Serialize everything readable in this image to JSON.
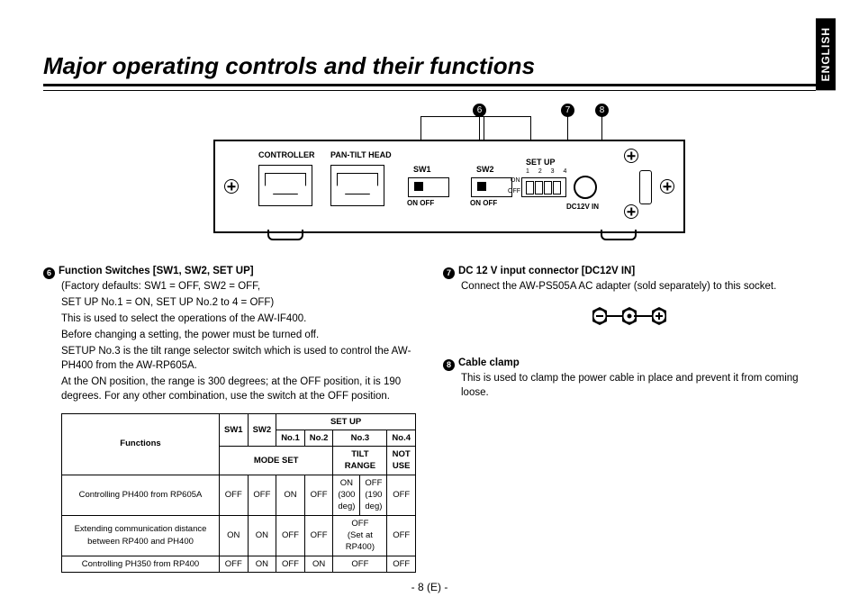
{
  "lang_tab": "ENGLISH",
  "title": "Major operating controls and their functions",
  "page_number": "- 8 (E) -",
  "callouts": {
    "c6": "6",
    "c7": "7",
    "c8": "8"
  },
  "diagram": {
    "controller_label": "CONTROLLER",
    "pth_label": "PAN-TILT HEAD",
    "sw1": "SW1",
    "sw2": "SW2",
    "setup": "SET UP",
    "on": "ON",
    "off": "OFF",
    "onoff": "ON  OFF",
    "dip_nums": "1 2 3 4",
    "dc12v": "DC12V IN"
  },
  "item6": {
    "num": "6",
    "heading": "Function Switches [SW1, SW2, SET UP]",
    "l1": "(Factory defaults: SW1 = OFF, SW2 = OFF,",
    "l2": "SET UP No.1 = ON, SET UP No.2 to 4 = OFF)",
    "l3": "This is used to select the operations of the AW-IF400.",
    "l4": "Before changing a setting, the power must be turned off.",
    "l5": "SETUP No.3 is the tilt range selector switch which is used to control the AW-PH400 from the AW-RP605A.",
    "l6": "At the ON position, the range is 300 degrees; at the OFF position, it is 190 degrees. For any other combination, use the switch at the OFF position."
  },
  "item7": {
    "num": "7",
    "heading": "DC 12 V input connector [DC12V IN]",
    "l1": "Connect the AW-PS505A AC adapter (sold separately) to this socket."
  },
  "item8": {
    "num": "8",
    "heading": "Cable clamp",
    "l1": "This is used to clamp the power cable in place and prevent it from coming loose."
  },
  "table": {
    "h_functions": "Functions",
    "h_sw1": "SW1",
    "h_sw2": "SW2",
    "h_setup": "SET UP",
    "h_no1": "No.1",
    "h_no2": "No.2",
    "h_no3": "No.3",
    "h_no4": "No.4",
    "h_mode": "MODE SET",
    "h_tilt": "TILT RANGE",
    "h_notuse": "NOT USE",
    "r1_fn": "Controlling PH400 from RP605A",
    "r1": {
      "sw1": "OFF",
      "sw2": "OFF",
      "n1": "ON",
      "n2": "OFF",
      "n3a": "ON\n(300 deg)",
      "n3b": "OFF\n(190 deg)",
      "n4": "OFF"
    },
    "r2_fn": "Extending communication distance between RP400 and PH400",
    "r2": {
      "sw1": "ON",
      "sw2": "ON",
      "n1": "OFF",
      "n2": "OFF",
      "n3": "OFF\n(Set at RP400)",
      "n4": "OFF"
    },
    "r3_fn": "Controlling PH350 from RP400",
    "r3": {
      "sw1": "OFF",
      "sw2": "ON",
      "n1": "OFF",
      "n2": "ON",
      "n3": "OFF",
      "n4": "OFF"
    }
  }
}
